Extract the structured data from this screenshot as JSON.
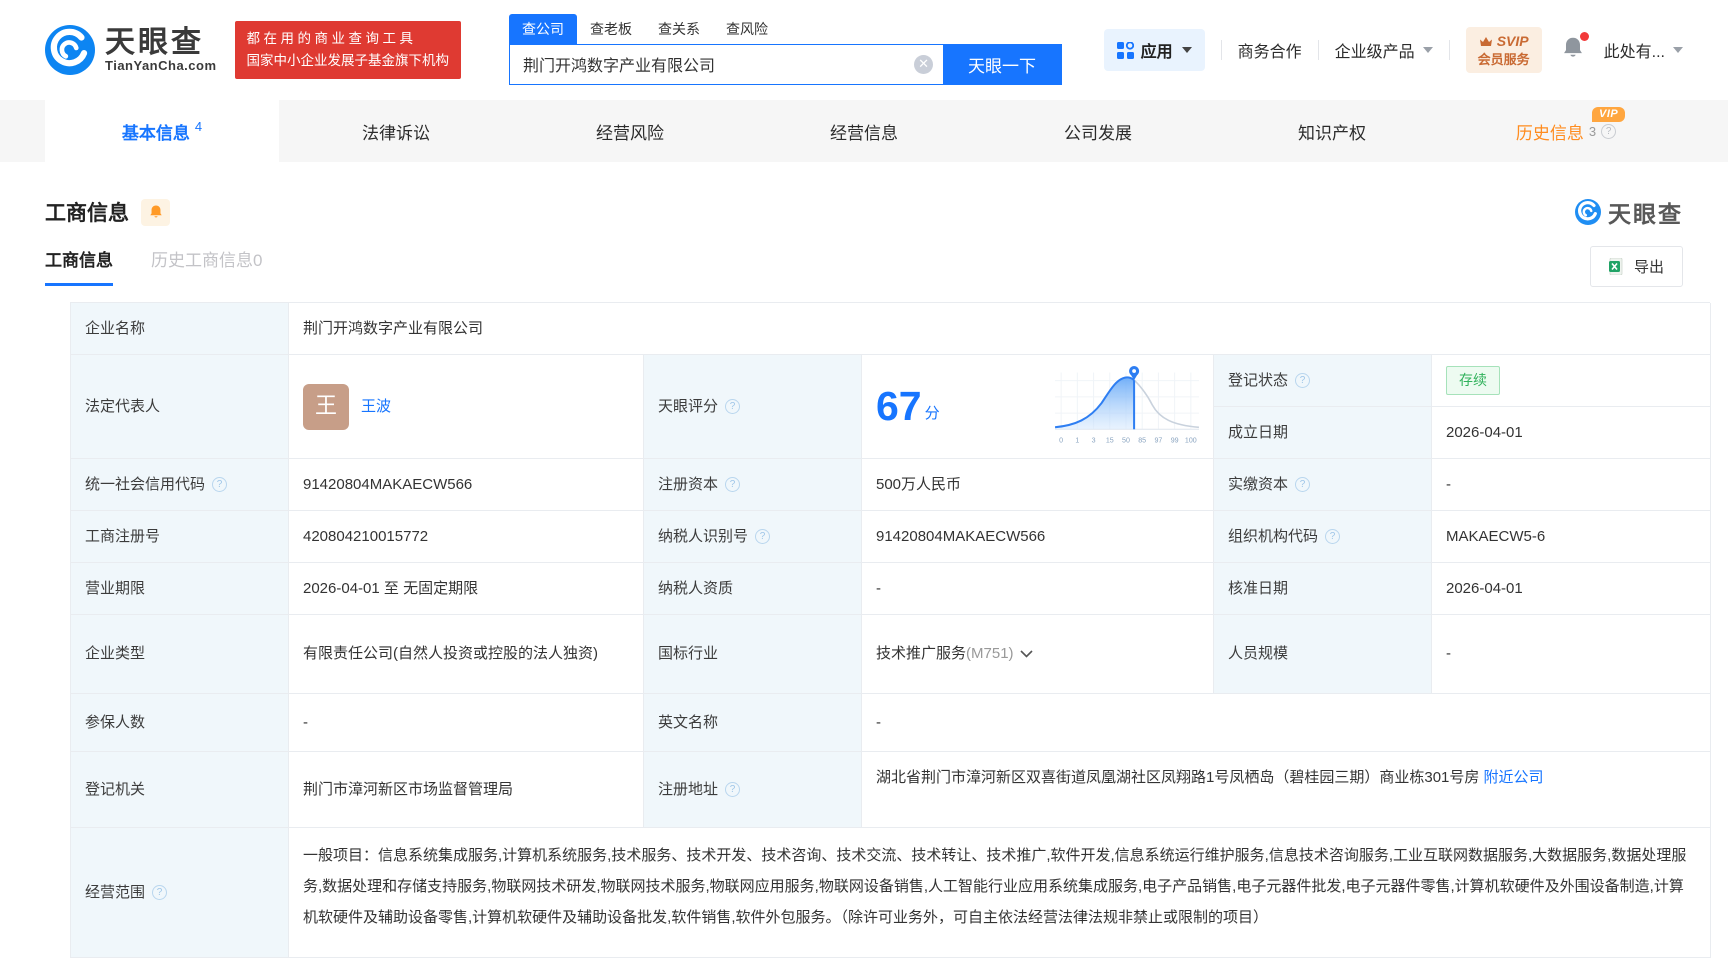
{
  "brand": {
    "name": "天眼查",
    "domain": "TianYanCha.com",
    "slogan_line1": "都在用的商业查询工具",
    "slogan_line2": "国家中小企业发展子基金旗下机构"
  },
  "search": {
    "tabs": [
      {
        "label": "查公司",
        "active": true
      },
      {
        "label": "查老板",
        "active": false
      },
      {
        "label": "查关系",
        "active": false
      },
      {
        "label": "查风险",
        "active": false
      }
    ],
    "value": "荆门开鸿数字产业有限公司",
    "button_label": "天眼一下"
  },
  "header_nav": {
    "apps": "应用",
    "business_coop": "商务合作",
    "enterprise_products": "企业级产品",
    "svip_line1": "SVIP",
    "svip_line2": "会员服务",
    "user": "此处有..."
  },
  "nav_tabs": [
    {
      "label": "基本信息",
      "count": "4",
      "active": true
    },
    {
      "label": "法律诉讼"
    },
    {
      "label": "经营风险"
    },
    {
      "label": "经营信息"
    },
    {
      "label": "公司发展"
    },
    {
      "label": "知识产权"
    },
    {
      "label": "历史信息",
      "count": "3",
      "vip_badge": "VIP"
    }
  ],
  "section": {
    "title": "工商信息",
    "subtab_active": "工商信息",
    "subtab_history": "历史工商信息0",
    "export_label": "导出",
    "watermark": "天眼查"
  },
  "table": {
    "labels": {
      "name": "企业名称",
      "legal_rep": "法定代表人",
      "reg_status": "登记状态",
      "est_date": "成立日期",
      "score": "天眼评分",
      "uscc": "统一社会信用代码",
      "reg_capital": "注册资本",
      "paid_capital": "实缴资本",
      "reg_no": "工商注册号",
      "taxpayer_id": "纳税人识别号",
      "org_code": "组织机构代码",
      "biz_term": "营业期限",
      "taxpayer_qual": "纳税人资质",
      "approval_date": "核准日期",
      "company_type": "企业类型",
      "industry": "国标行业",
      "staff_size": "人员规模",
      "insured_count": "参保人数",
      "english_name": "英文名称",
      "reg_authority": "登记机关",
      "reg_address": "注册地址",
      "biz_scope": "经营范围"
    },
    "values": {
      "name": "荆门开鸿数字产业有限公司",
      "legal_rep": "王波",
      "legal_rep_avatar": "王",
      "reg_status": "存续",
      "est_date": "2026-04-01",
      "uscc": "91420804MAKAECW566",
      "reg_capital": "500万人民币",
      "paid_capital": "-",
      "reg_no": "420804210015772",
      "taxpayer_id": "91420804MAKAECW566",
      "org_code": "MAKAECW5-6",
      "biz_term": "2026-04-01 至 无固定期限",
      "taxpayer_qual": "-",
      "approval_date": "2026-04-01",
      "company_type": "有限责任公司(自然人投资或控股的法人独资)",
      "industry": "技术推广服务",
      "industry_code": "(M751)",
      "staff_size": "-",
      "insured_count": "-",
      "english_name": "-",
      "reg_authority": "荆门市漳河新区市场监督管理局",
      "reg_address": "湖北省荆门市漳河新区双喜街道凤凰湖社区凤翔路1号凤栖岛（碧桂园三期）商业栋301号房",
      "nearby_link": "附近公司",
      "biz_scope": "一般项目：信息系统集成服务,计算机系统服务,技术服务、技术开发、技术咨询、技术交流、技术转让、技术推广,软件开发,信息系统运行维护服务,信息技术咨询服务,工业互联网数据服务,大数据服务,数据处理服务,数据处理和存储支持服务,物联网技术研发,物联网技术服务,物联网应用服务,物联网设备销售,人工智能行业应用系统集成服务,电子产品销售,电子元器件批发,电子元器件零售,计算机软硬件及外围设备制造,计算机软硬件及辅助设备零售,计算机软硬件及辅助设备批发,软件销售,软件外包服务。（除许可业务外，可自主依法经营法律法规非禁止或限制的项目）"
    }
  },
  "chart_data": {
    "type": "area",
    "title": "天眼评分",
    "score": 67,
    "score_text": "67",
    "score_unit": "分",
    "x_ticks": [
      "0",
      "1",
      "3",
      "15",
      "50",
      "85",
      "97",
      "99",
      "100"
    ],
    "marker_value": 67,
    "marker_between_ticks": [
      50,
      85
    ],
    "grid": true,
    "legend_position": "none",
    "series": [
      {
        "name": "score-distribution-curve",
        "shape": "log-normal bell curve, low left tail, peak between ticks 50 and 85, long right tail to 100",
        "filled_region": "area left of score marker filled with blue gradient",
        "unfilled_region": "curve right of marker drawn in light gray",
        "points_norm_x_height": [
          [
            0,
            0.04
          ],
          [
            10,
            0.07
          ],
          [
            20,
            0.15
          ],
          [
            30,
            0.35
          ],
          [
            40,
            0.68
          ],
          [
            48,
            0.92
          ],
          [
            54,
            1.0
          ],
          [
            58,
            0.95
          ],
          [
            66,
            0.72
          ],
          [
            74,
            0.45
          ],
          [
            82,
            0.25
          ],
          [
            90,
            0.1
          ],
          [
            100,
            0.05
          ]
        ]
      }
    ]
  },
  "colors": {
    "primary_blue": "#1775ff",
    "logo_blue": "#0d85f2",
    "badge_red": "#df3a32",
    "label_cell_bg": "#f0f7fb",
    "border": "#e9ecf0",
    "status_green": "#31b25c",
    "history_orange": "#ff8c1f",
    "vip_orange": "#ffa63f",
    "svip_text": "#c96a33",
    "avatar_tan": "#c79e88",
    "excel_green": "#21a366"
  }
}
